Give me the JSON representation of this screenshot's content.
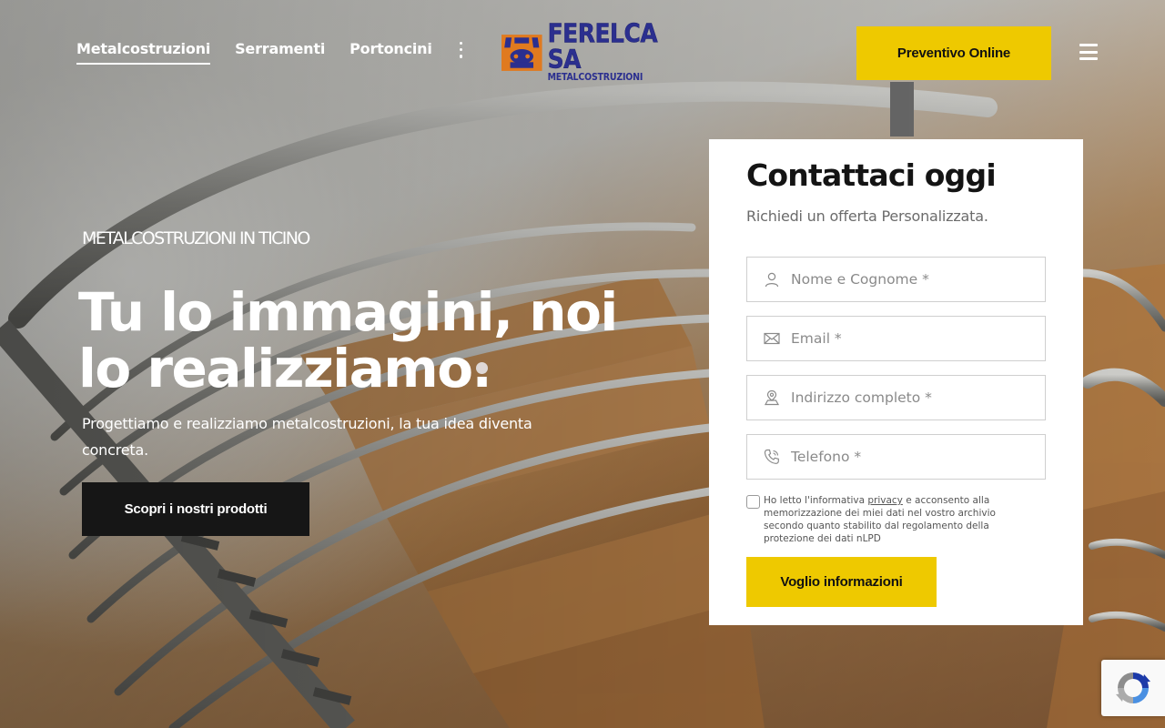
{
  "nav": {
    "items": [
      {
        "label": "Metalcostruzioni",
        "active": true
      },
      {
        "label": "Serramenti",
        "active": false
      },
      {
        "label": "Portoncini",
        "active": false
      }
    ],
    "more_icon": "kebab-vertical-icon"
  },
  "logo": {
    "name": "FERELCA SA",
    "subtitle": "METALCOSTRUZIONI"
  },
  "header": {
    "cta_label": "Preventivo Online",
    "menu_icon": "hamburger-menu-icon"
  },
  "hero": {
    "eyebrow": "METALCOSTRUZIONI IN TICINO",
    "headline": "Tu lo immagini, noi lo realizziamo.",
    "subtext": "Progettiamo e realizziamo metalcostruzioni, la tua idea diventa concreta.",
    "cta_label": "Scopri i nostri prodotti"
  },
  "form": {
    "title": "Contattaci oggi",
    "subtitle": "Richiedi un offerta Personalizzata.",
    "fields": [
      {
        "placeholder": "Nome e Cognome *",
        "icon": "user-icon",
        "value": ""
      },
      {
        "placeholder": "Email *",
        "icon": "envelope-icon",
        "value": ""
      },
      {
        "placeholder": "Indirizzo completo *",
        "icon": "map-pin-icon",
        "value": ""
      },
      {
        "placeholder": "Telefono *",
        "icon": "phone-icon",
        "value": ""
      }
    ],
    "consent_before": "Ho letto l'informativa ",
    "consent_link": "privacy",
    "consent_after": " e acconsento alla memorizzazione dei miei dati nel vostro archivio secondo quanto stabilito dal regolamento della protezione dei dati nLPD",
    "consent_checked": false,
    "submit_label": "Voglio informazioni"
  },
  "colors": {
    "accent": "#eec900",
    "dark_button": "#161616",
    "logo_blue": "#2b2f8f",
    "logo_orange": "#e07a1f"
  }
}
